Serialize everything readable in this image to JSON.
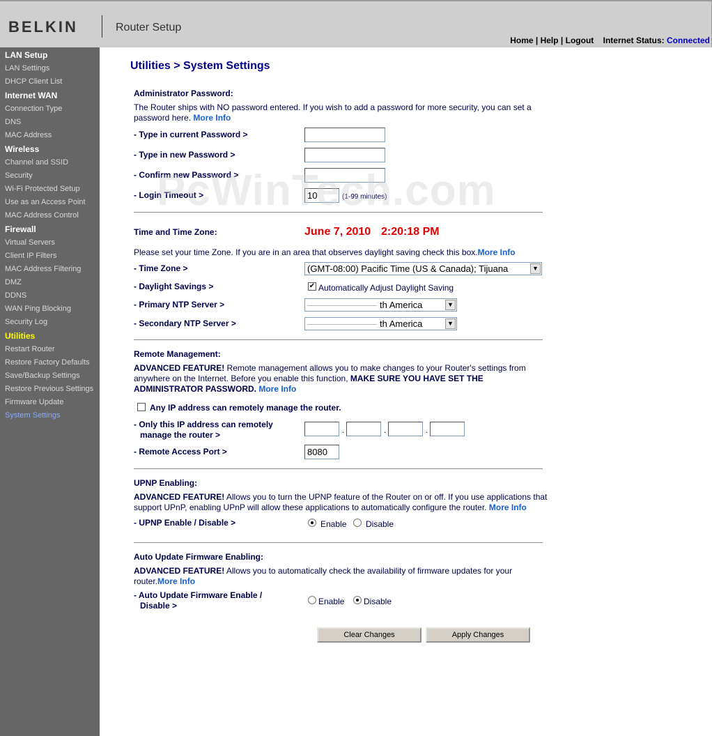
{
  "header": {
    "logo": "BELKIN",
    "product": "Router Setup",
    "links": [
      "Home",
      "Help",
      "Logout"
    ],
    "status_label": "Internet Status:",
    "status_value": "Connected"
  },
  "sidebar": {
    "sections": [
      {
        "heading": "LAN Setup",
        "items": [
          "LAN Settings",
          "DHCP Client List"
        ]
      },
      {
        "heading": "Internet WAN",
        "items": [
          "Connection Type",
          "DNS",
          "MAC Address"
        ]
      },
      {
        "heading": "Wireless",
        "items": [
          "Channel and SSID",
          "Security",
          "Wi-Fi Protected Setup",
          "Use as an Access Point",
          "MAC Address Control"
        ]
      },
      {
        "heading": "Firewall",
        "items": [
          "Virtual Servers",
          "Client IP Filters",
          "MAC Address Filtering",
          "DMZ",
          "DDNS",
          "WAN Ping Blocking",
          "Security Log"
        ]
      },
      {
        "heading": "Utilities",
        "items": [
          "Restart Router",
          "Restore Factory Defaults",
          "Save/Backup Settings",
          "Restore Previous Settings",
          "Firmware Update",
          "System Settings"
        ]
      }
    ]
  },
  "page": {
    "title": "Utilities > System Settings",
    "watermark": "PcWinTech.com"
  },
  "admin": {
    "title": "Administrator Password:",
    "desc1": "The Router ships with NO password entered. If you wish to add a password for more security, you can set a",
    "desc2": "password here.",
    "more": "More Info",
    "current_label": "- Type in current Password >",
    "new_label": "- Type in new Password >",
    "confirm_label": "- Confirm new Password >",
    "timeout_label": "- Login Timeout >",
    "timeout_value": "10",
    "timeout_hint": "(1-99 minutes)"
  },
  "time": {
    "title": "Time and Time Zone:",
    "date": "June 7, 2010",
    "clock": "2:20:18 PM",
    "desc": "Please set your time Zone. If you are in an area that observes daylight saving check this box.",
    "more": "More Info",
    "tz_label": "- Time Zone >",
    "tz_value": "(GMT-08:00) Pacific Time (US & Canada); Tijuana",
    "dst_label": "- Daylight Savings >",
    "dst_text": "Automatically Adjust Daylight Saving",
    "ntp1_label": "- Primary NTP Server >",
    "ntp1_value": "th America",
    "ntp2_label": "- Secondary NTP Server >",
    "ntp2_value": "th America"
  },
  "remote": {
    "title": "Remote Management:",
    "adv": "ADVANCED FEATURE!",
    "desc1": " Remote management allows you to make changes to your Router's settings from",
    "desc2": "anywhere on the Internet. Before you enable this function, ",
    "desc2_bold": "MAKE SURE YOU HAVE SET THE",
    "desc3_bold": "ADMINISTRATOR PASSWORD.",
    "more": "More Info",
    "any_ip_label": "Any IP address can remotely manage the router.",
    "only_ip_label1": "- Only this IP address can remotely",
    "only_ip_label2": "manage the router >",
    "port_label": "- Remote Access Port >",
    "port_value": "8080"
  },
  "upnp": {
    "title": "UPNP Enabling:",
    "adv": "ADVANCED FEATURE!",
    "desc1": " Allows you to turn the UPNP feature of the Router on or off. If you use applications that",
    "desc2": "support UPnP, enabling UPnP will allow these applications to automatically configure the router.",
    "more": "More Info",
    "label": "- UPNP Enable / Disable >",
    "enable": "Enable",
    "disable": "Disable"
  },
  "autoupdate": {
    "title": "Auto Update Firmware Enabling:",
    "adv": "ADVANCED FEATURE!",
    "desc1": " Allows you to automatically check the availability of firmware updates for your",
    "desc2": "router.",
    "more": "More Info",
    "label1": "- Auto Update Firmware Enable /",
    "label2": "Disable >",
    "enable": "Enable",
    "disable": "Disable"
  },
  "buttons": {
    "clear": "Clear Changes",
    "apply": "Apply Changes"
  }
}
